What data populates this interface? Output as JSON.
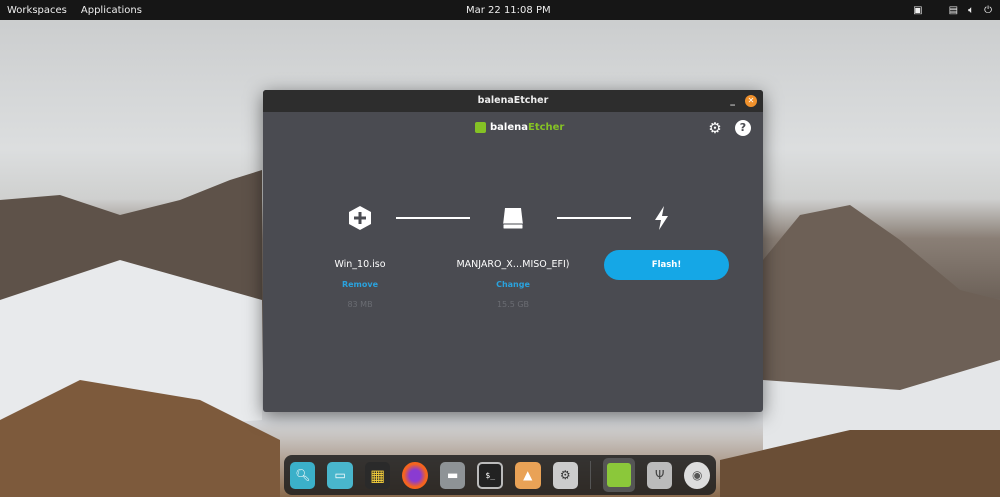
{
  "topbar": {
    "workspaces": "Workspaces",
    "applications": "Applications",
    "datetime": "Mar 22  11:08 PM"
  },
  "window": {
    "title": "balenaEtcher",
    "logo_prefix": "balena",
    "logo_suffix": "Etcher",
    "steps": [
      {
        "name": "Win_10.iso",
        "action": "Remove",
        "size": "83 MB"
      },
      {
        "name": "MANJARO_X…MISO_EFI)",
        "action": "Change",
        "size": "15.5 GB"
      }
    ],
    "flash_label": "Flash!"
  },
  "colors": {
    "accent": "#15a7e6",
    "brand": "#85c225",
    "close": "#f0912c"
  },
  "dock": [
    "search-icon",
    "workspaces-icon",
    "app-grid-icon",
    "firefox-icon",
    "files-icon",
    "terminal-icon",
    "installer-icon",
    "settings-icon",
    "etcher-icon",
    "usb-icon",
    "disc-icon"
  ]
}
